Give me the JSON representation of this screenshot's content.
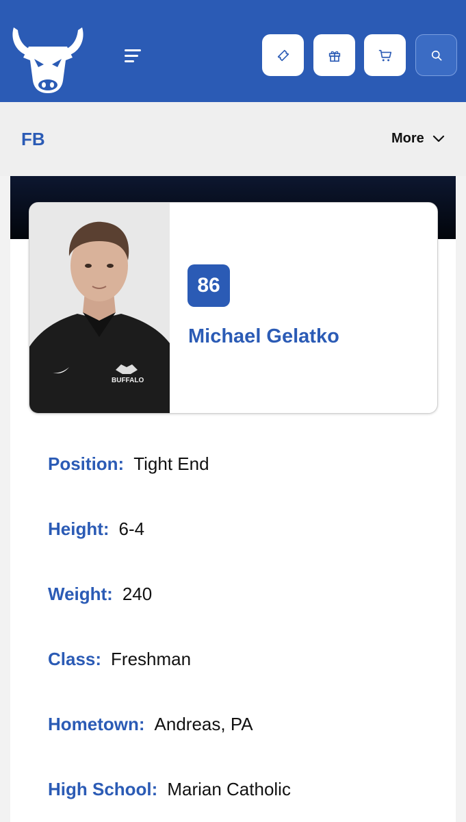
{
  "header": {
    "logo_icon": "bull-logo",
    "menu_icon": "hamburger-menu-icon",
    "buttons": [
      {
        "icon": "ticket-icon"
      },
      {
        "icon": "gift-icon"
      },
      {
        "icon": "cart-icon"
      },
      {
        "icon": "search-icon"
      }
    ],
    "brand_color": "#2b5bb5"
  },
  "subnav": {
    "sport": "FB",
    "more_label": "More"
  },
  "player": {
    "number": "86",
    "name": "Michael Gelatko",
    "details": [
      {
        "label": "Position:",
        "value": "Tight End"
      },
      {
        "label": "Height:",
        "value": "6-4"
      },
      {
        "label": "Weight:",
        "value": "240"
      },
      {
        "label": "Class:",
        "value": "Freshman"
      },
      {
        "label": "Hometown:",
        "value": "Andreas, PA"
      },
      {
        "label": "High School:",
        "value": "Marian Catholic"
      }
    ]
  }
}
